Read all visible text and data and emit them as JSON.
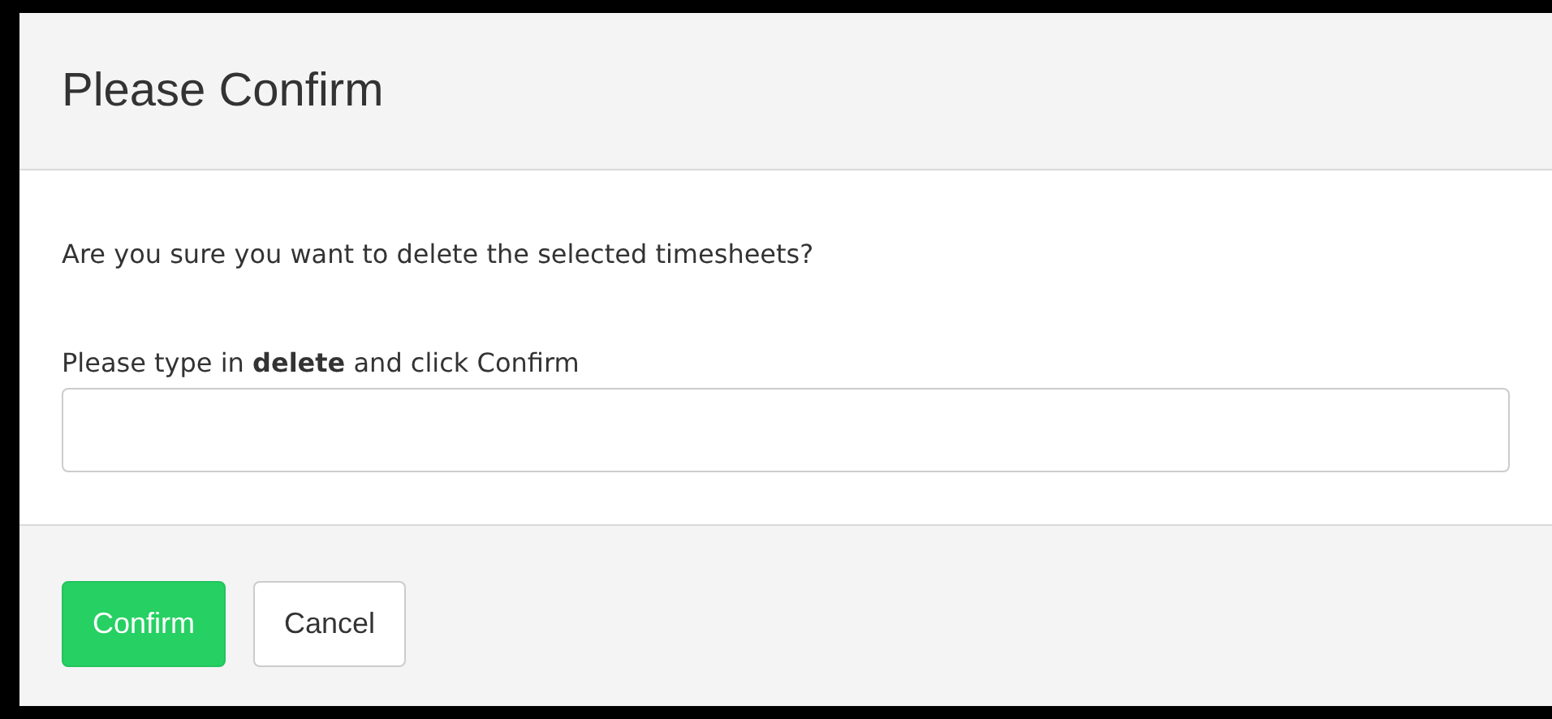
{
  "dialog": {
    "title": "Please Confirm",
    "message": "Are you sure you want to delete the selected timesheets?",
    "prompt": "Please type in **delete** and click Confirm",
    "buttons": [
      {
        "label": "Confirm",
        "kind": "primary"
      },
      {
        "label": "Cancel",
        "kind": "default"
      }
    ]
  }
}
